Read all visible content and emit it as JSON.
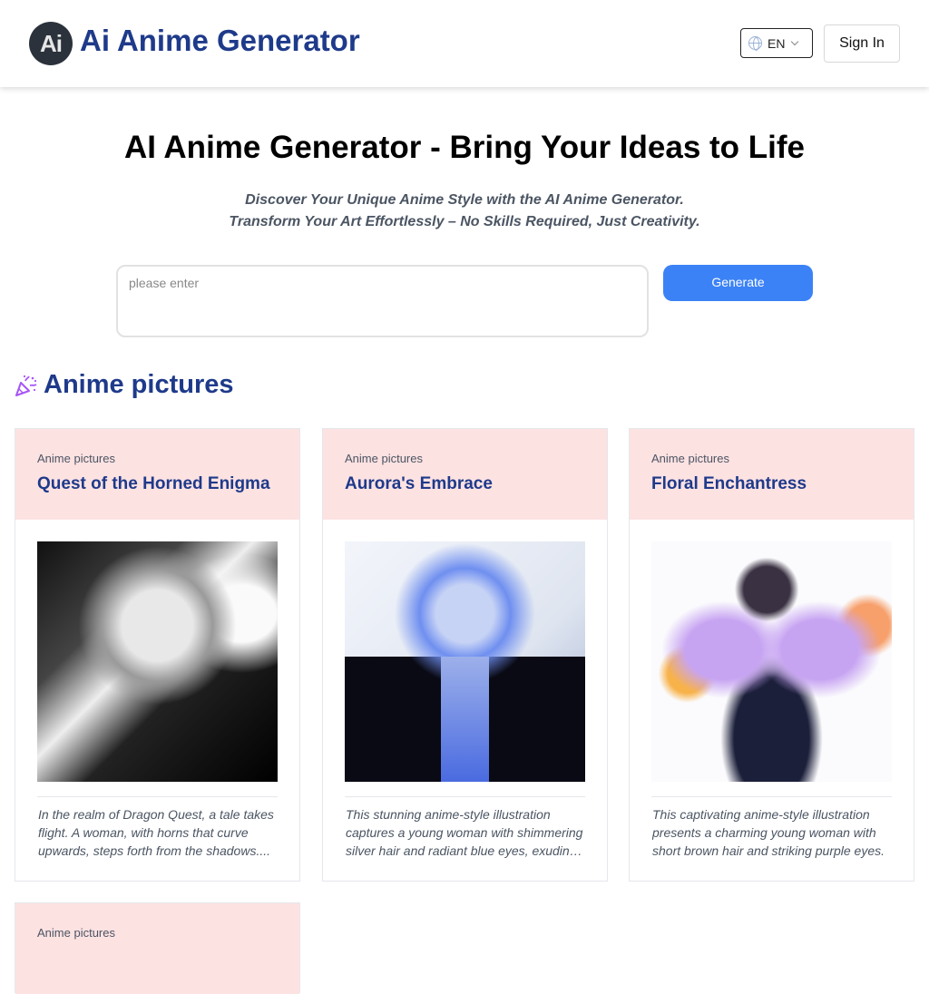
{
  "header": {
    "logo_text": "Ai",
    "brand": "Ai Anime Generator",
    "language": "EN",
    "sign_in": "Sign In"
  },
  "hero": {
    "title": "AI Anime Generator - Bring Your Ideas to Life",
    "subtitle_line1": "Discover Your Unique Anime Style with the AI Anime Generator.",
    "subtitle_line2": "Transform Your Art Effortlessly – No Skills Required, Just Creativity.",
    "prompt_placeholder": "please enter",
    "prompt_value": "",
    "generate_label": "Generate"
  },
  "section": {
    "icon": "party-popper-icon",
    "title": "Anime pictures"
  },
  "cards": [
    {
      "category": "Anime pictures",
      "title": "Quest of the Horned Enigma",
      "image_alt": "Monochrome anime girl with curved horns",
      "description": "In the realm of Dragon Quest, a tale takes flight. A woman, with horns that curve upwards, steps forth from the shadows...."
    },
    {
      "category": "Anime pictures",
      "title": "Aurora's Embrace",
      "image_alt": "Anime girl with blue hair in dark jacket",
      "description": "This stunning anime-style illustration captures a young woman with shimmering silver hair and radiant blue eyes, exuding a serene presence."
    },
    {
      "category": "Anime pictures",
      "title": "Floral Enchantress",
      "image_alt": "Anime girl with purple wings surrounded by flowers",
      "description": "This captivating anime-style illustration presents a charming young woman with short brown hair and striking purple eyes."
    },
    {
      "category": "Anime pictures",
      "title": "",
      "image_alt": "",
      "description": ""
    }
  ]
}
